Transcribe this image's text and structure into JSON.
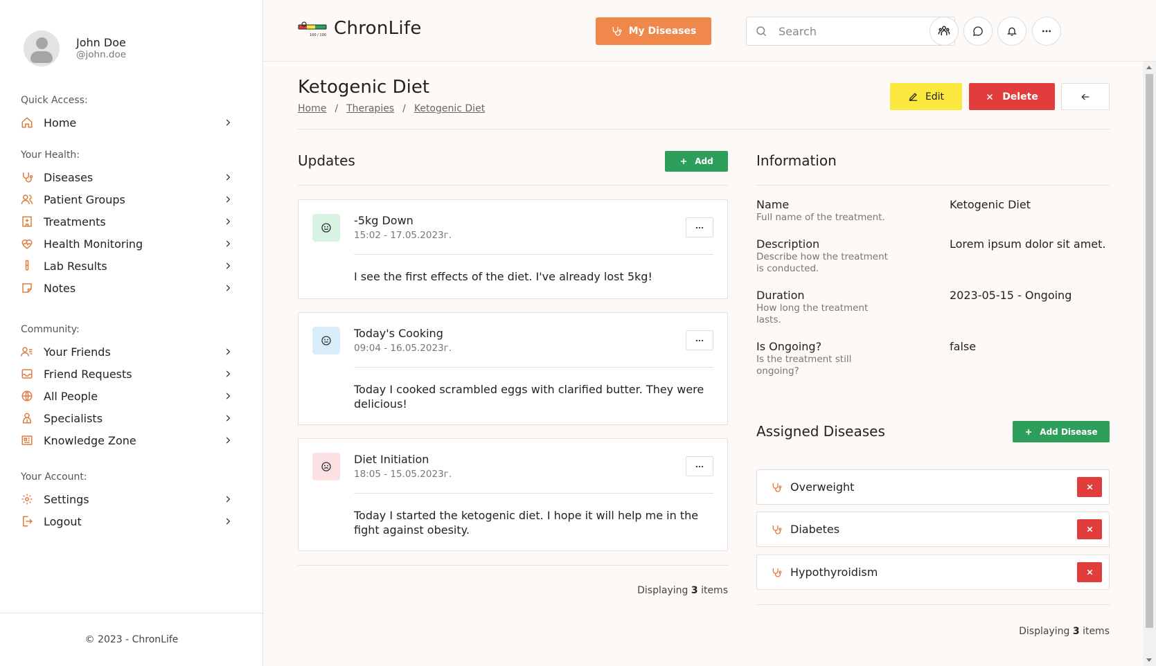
{
  "profile": {
    "name": "John Doe",
    "handle": "@john.doe"
  },
  "sidebar": {
    "sections": [
      {
        "heading": "Quick Access:",
        "items": [
          {
            "label": "Home",
            "icon": "home-icon"
          }
        ]
      },
      {
        "heading": "Your Health:",
        "items": [
          {
            "label": "Diseases",
            "icon": "stethoscope-icon"
          },
          {
            "label": "Patient Groups",
            "icon": "users-icon"
          },
          {
            "label": "Treatments",
            "icon": "hospital-icon"
          },
          {
            "label": "Health Monitoring",
            "icon": "heart-pulse-icon"
          },
          {
            "label": "Lab Results",
            "icon": "test-tube-icon"
          },
          {
            "label": "Notes",
            "icon": "note-icon"
          }
        ]
      },
      {
        "heading": "Community:",
        "items": [
          {
            "label": "Your Friends",
            "icon": "user-list-icon"
          },
          {
            "label": "Friend Requests",
            "icon": "inbox-icon"
          },
          {
            "label": "All People",
            "icon": "globe-icon"
          },
          {
            "label": "Specialists",
            "icon": "specialist-icon"
          },
          {
            "label": "Knowledge Zone",
            "icon": "newspaper-icon"
          }
        ]
      },
      {
        "heading": "Your Account:",
        "items": [
          {
            "label": "Settings",
            "icon": "gear-icon"
          },
          {
            "label": "Logout",
            "icon": "logout-icon"
          }
        ]
      }
    ],
    "footer": "© 2023 - ChronLife"
  },
  "header": {
    "logo_text": "ChronLife",
    "logo_badge": "100 / 100",
    "my_diseases_label": "My Diseases",
    "search_placeholder": "Search"
  },
  "page": {
    "title": "Ketogenic Diet",
    "breadcrumb": [
      "Home",
      "Therapies",
      "Ketogenic Diet"
    ],
    "edit_label": "Edit",
    "delete_label": "Delete"
  },
  "updates": {
    "title": "Updates",
    "add_label": "Add",
    "items": [
      {
        "title": "-5kg Down",
        "time": "15:02 - 17.05.2023г.",
        "body": "I see the first effects of the diet. I've already lost 5kg!",
        "mood": "happy"
      },
      {
        "title": "Today's Cooking",
        "time": "09:04 - 16.05.2023г.",
        "body": "Today I cooked scrambled eggs with clarified butter. They were delicious!",
        "mood": "neutral"
      },
      {
        "title": "Diet Initiation",
        "time": "18:05 - 15.05.2023г.",
        "body": "Today I started the ketogenic diet. I hope it will help me in the fight against obesity.",
        "mood": "worried"
      }
    ],
    "displaying_prefix": "Displaying",
    "displaying_count": "3",
    "displaying_suffix": "items"
  },
  "information": {
    "title": "Information",
    "rows": [
      {
        "label": "Name",
        "desc": "Full name of the treatment.",
        "value": "Ketogenic Diet"
      },
      {
        "label": "Description",
        "desc": "Describe how the treatment is conducted.",
        "value": "Lorem ipsum dolor sit amet."
      },
      {
        "label": "Duration",
        "desc": "How long the treatment lasts.",
        "value": "2023-05-15 - Ongoing"
      },
      {
        "label": "Is Ongoing?",
        "desc": "Is the treatment still ongoing?",
        "value": "false"
      }
    ]
  },
  "assigned": {
    "title": "Assigned Diseases",
    "add_label": "Add Disease",
    "items": [
      "Overweight",
      "Diabetes",
      "Hypothyroidism"
    ],
    "displaying_prefix": "Displaying",
    "displaying_count": "3",
    "displaying_suffix": "items"
  },
  "colors": {
    "accent": "#f0884b",
    "green": "#2e9e5b",
    "red": "#e13d3d",
    "yellow": "#fae83e",
    "mood_happy_bg": "#d9f3e3",
    "mood_neutral_bg": "#d9eefa",
    "mood_worried_bg": "#fbe1e1"
  }
}
